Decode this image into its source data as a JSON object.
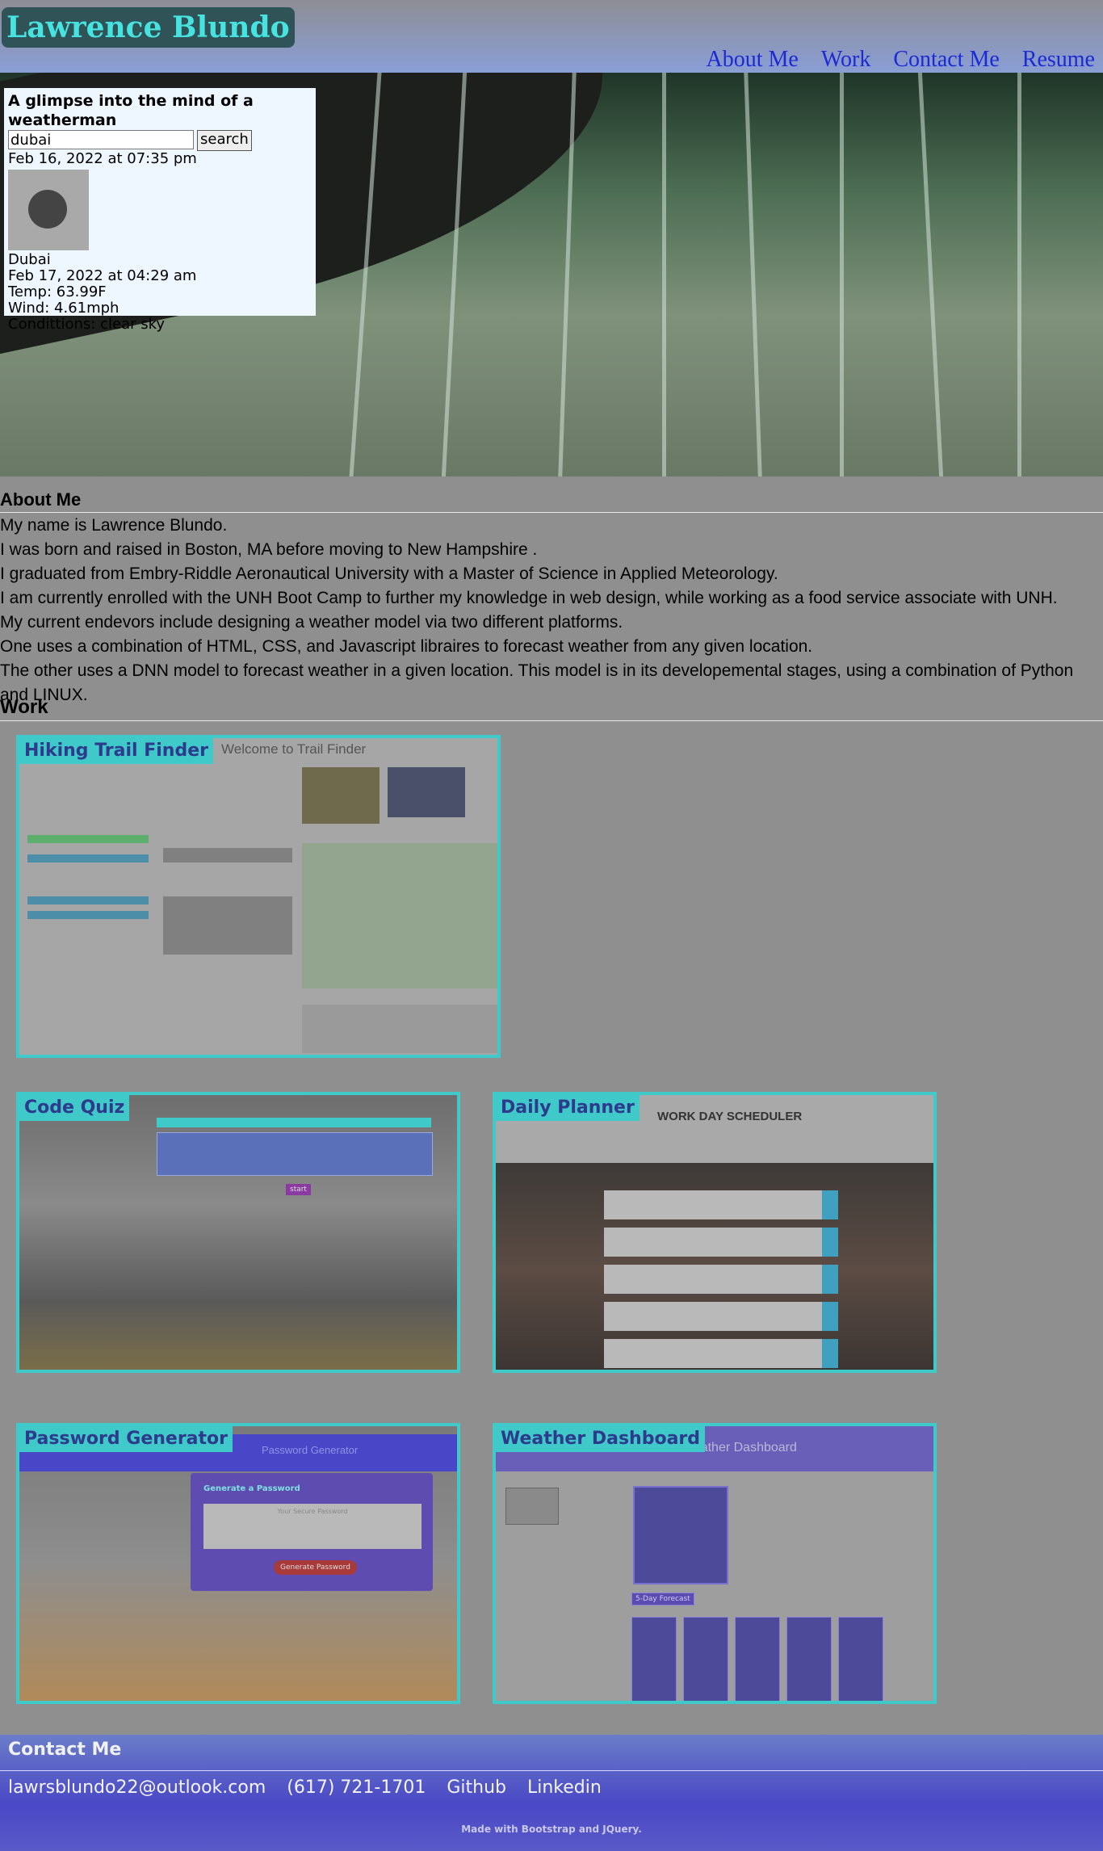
{
  "header": {
    "site_title": "Lawrence Blundo",
    "nav": [
      "About Me",
      "Work",
      "Contact Me",
      "Resume"
    ]
  },
  "weather_widget": {
    "title": "A glimpse into the mind of a weatherman",
    "search_value": "dubai",
    "search_button": "search",
    "current_time": "Feb 16, 2022 at 07:35 pm",
    "city": "Dubai",
    "date": "Feb 17, 2022 at 04:29 am",
    "temp": "Temp: 63.99F",
    "wind": "Wind: 4.61mph",
    "conditions": "Condittions: clear sky"
  },
  "about": {
    "heading": "About Me",
    "lines": [
      "My name is Lawrence Blundo.",
      "I was born and raised in Boston, MA before moving to New Hampshire .",
      "I graduated from Embry-Riddle Aeronautical University with a Master of Science in Applied Meteorology.",
      "I am currently enrolled with the UNH Boot Camp to further my knowledge in web design, while working as a food service associate with UNH.",
      "My current endevors include designing a weather model via two different platforms.",
      "One uses a combination of HTML, CSS, and Javascript libraires to forecast weather from any given location.",
      "The other uses a DNN model to forecast weather in a given location. This model is in its developemental stages, using a combination of Python and LINUX."
    ]
  },
  "work": {
    "heading": "Work",
    "projects": [
      {
        "title": "Hiking Trail Finder",
        "screenshot_heading": "Welcome to Trail Finder"
      },
      {
        "title": "Code Quiz",
        "screenshot_button": "start"
      },
      {
        "title": "Daily Planner",
        "screenshot_heading": "WORK DAY SCHEDULER"
      },
      {
        "title": "Password Generator",
        "screenshot_heading": "Password Generator",
        "screenshot_subheading": "Generate a Password",
        "screenshot_placeholder": "Your Secure Password",
        "screenshot_button": "Generate Password"
      },
      {
        "title": "Weather Dashboard",
        "screenshot_heading": "Weather Dashboard",
        "screenshot_forecast": "5-Day Forecast"
      }
    ]
  },
  "contact": {
    "heading": "Contact Me",
    "email": "lawrsblundo22@outlook.com",
    "phone": "(617) 721-1701",
    "github": "Github",
    "linkedin": "Linkedin",
    "note": "Made with Bootstrap and JQuery."
  },
  "colors": {
    "accent": "#3fc9c9",
    "nav_link": "#1c2ad6",
    "title_text": "#46e3e0",
    "footer": "#4a48c6"
  }
}
